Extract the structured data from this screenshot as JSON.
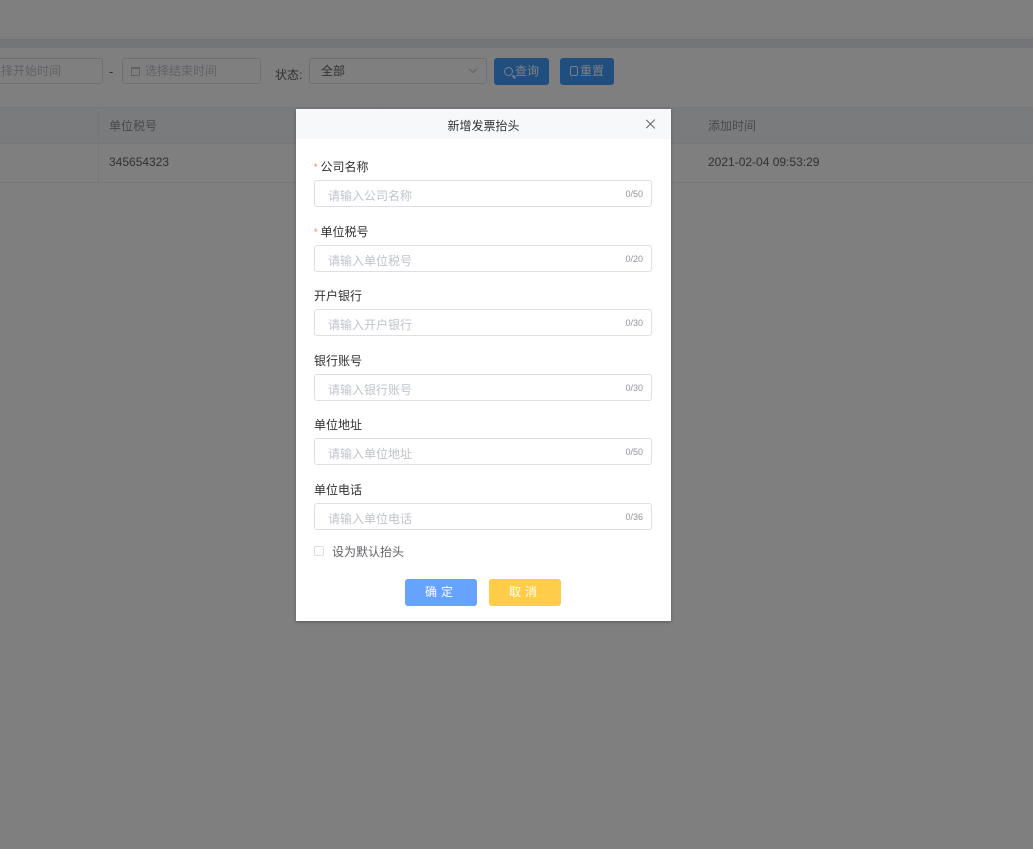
{
  "filters": {
    "start_date_placeholder": "择开始时间",
    "separator": "-",
    "end_date_placeholder": "选择结束时间",
    "status_label": "状态:",
    "status_value": "全部",
    "query_button": "查询",
    "reset_button": "重置"
  },
  "table": {
    "columns": [
      "单位税号",
      "添加时间"
    ],
    "rows": [
      {
        "tax_no": "345654323",
        "added_time": "2021-02-04 09:53:29"
      }
    ]
  },
  "dialog": {
    "title": "新增发票抬头",
    "fields": [
      {
        "label": "公司名称",
        "required": true,
        "placeholder": "请输入公司名称",
        "counter": "0/50"
      },
      {
        "label": "单位税号",
        "required": true,
        "placeholder": "请输入单位税号",
        "counter": "0/20"
      },
      {
        "label": "开户银行",
        "required": false,
        "placeholder": "请输入开户银行",
        "counter": "0/30"
      },
      {
        "label": "银行账号",
        "required": false,
        "placeholder": "请输入银行账号",
        "counter": "0/30"
      },
      {
        "label": "单位地址",
        "required": false,
        "placeholder": "请输入单位地址",
        "counter": "0/50"
      },
      {
        "label": "单位电话",
        "required": false,
        "placeholder": "请输入单位电话",
        "counter": "0/36"
      }
    ],
    "default_checkbox_label": "设为默认抬头",
    "confirm_button": "确定",
    "cancel_button": "取消"
  },
  "colors": {
    "primary": "#409eff",
    "confirm": "#66a3ff",
    "cancel": "#ffcd4a",
    "required_mark": "#f56c6c"
  },
  "icons": [
    "calendar-icon",
    "chevron-down-icon",
    "search-icon",
    "refresh-icon",
    "close-icon"
  ]
}
